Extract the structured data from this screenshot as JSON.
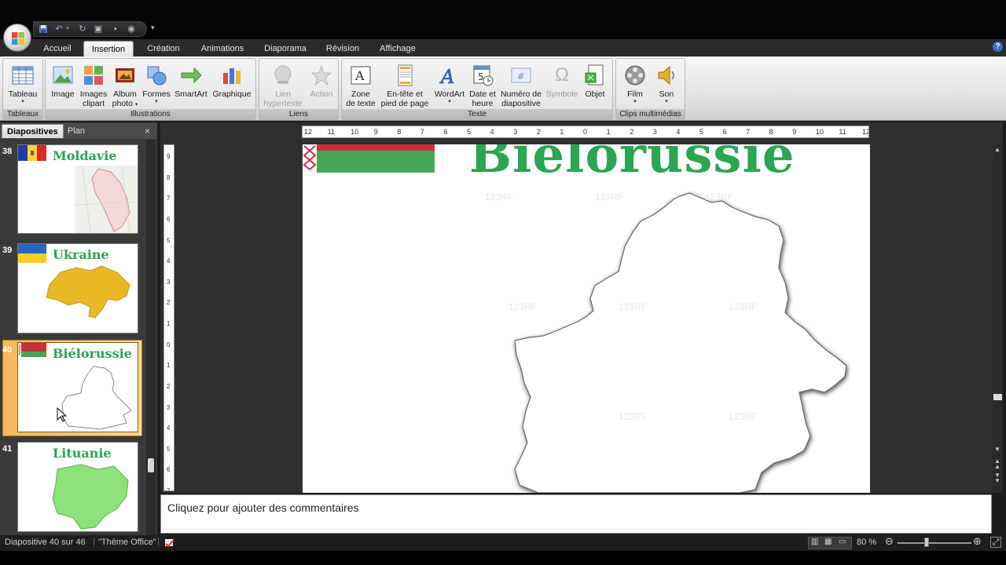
{
  "qat": {
    "icons": [
      "save-icon",
      "undo-icon",
      "redo-icon",
      "print-icon",
      "new-slide-icon",
      "record-icon",
      "customize-icon"
    ]
  },
  "tabs": [
    "Accueil",
    "Insertion",
    "Création",
    "Animations",
    "Diaporama",
    "Révision",
    "Affichage"
  ],
  "active_tab": "Insertion",
  "ribbon": {
    "groups": {
      "tableaux": "Tableaux",
      "illustrations": "Illustrations",
      "liens": "Liens",
      "texte": "Texte",
      "clips": "Clips multimédias"
    },
    "buttons": {
      "tableau": "Tableau",
      "image": "Image",
      "images_clipart": [
        "Images",
        "clipart"
      ],
      "album_photo": [
        "Album",
        "photo"
      ],
      "formes": "Formes",
      "smartart": "SmartArt",
      "graphique": "Graphique",
      "lien_hypertexte": [
        "Lien",
        "hypertexte"
      ],
      "action": "Action",
      "zone_texte": [
        "Zone",
        "de texte"
      ],
      "entete": [
        "En-tête et",
        "pied de page"
      ],
      "wordart": "WordArt",
      "date_heure": [
        "Date et",
        "heure"
      ],
      "numero": [
        "Numéro de",
        "diapositive"
      ],
      "symbole": "Symbole",
      "objet": "Objet",
      "film": "Film",
      "son": "Son"
    }
  },
  "panel": {
    "tab_slides": "Diapositives",
    "tab_outline": "Plan",
    "close": "×"
  },
  "thumbnails": [
    {
      "index": "38",
      "title": "Moldavie"
    },
    {
      "index": "39",
      "title": "Ukraine"
    },
    {
      "index": "40",
      "title": "Biélorussie"
    },
    {
      "index": "41",
      "title": "Lituanie"
    }
  ],
  "selected_slide": "40",
  "ruler": {
    "h": [
      "12",
      "11",
      "10",
      "9",
      "8",
      "7",
      "6",
      "5",
      "4",
      "3",
      "2",
      "1",
      "0",
      "1",
      "2",
      "3",
      "4",
      "5",
      "6",
      "7",
      "8",
      "9",
      "10",
      "11",
      "12"
    ],
    "v": [
      "9",
      "8",
      "7",
      "6",
      "5",
      "4",
      "3",
      "2",
      "1",
      "0",
      "1",
      "2",
      "3",
      "4",
      "5",
      "6",
      "7"
    ]
  },
  "slide": {
    "title": "Biélorussie",
    "watermark": "123RF"
  },
  "notes_placeholder": "Cliquez pour ajouter des commentaires",
  "status": {
    "slide_info": "Diapositive 40 sur 46",
    "theme": "\"Thème Office\"",
    "zoom": "80 %"
  },
  "colors": {
    "title_green": "#2aa551",
    "flag_red": "#c8313e",
    "flag_green": "#4aa657",
    "accent_orange": "#f6b85c"
  }
}
